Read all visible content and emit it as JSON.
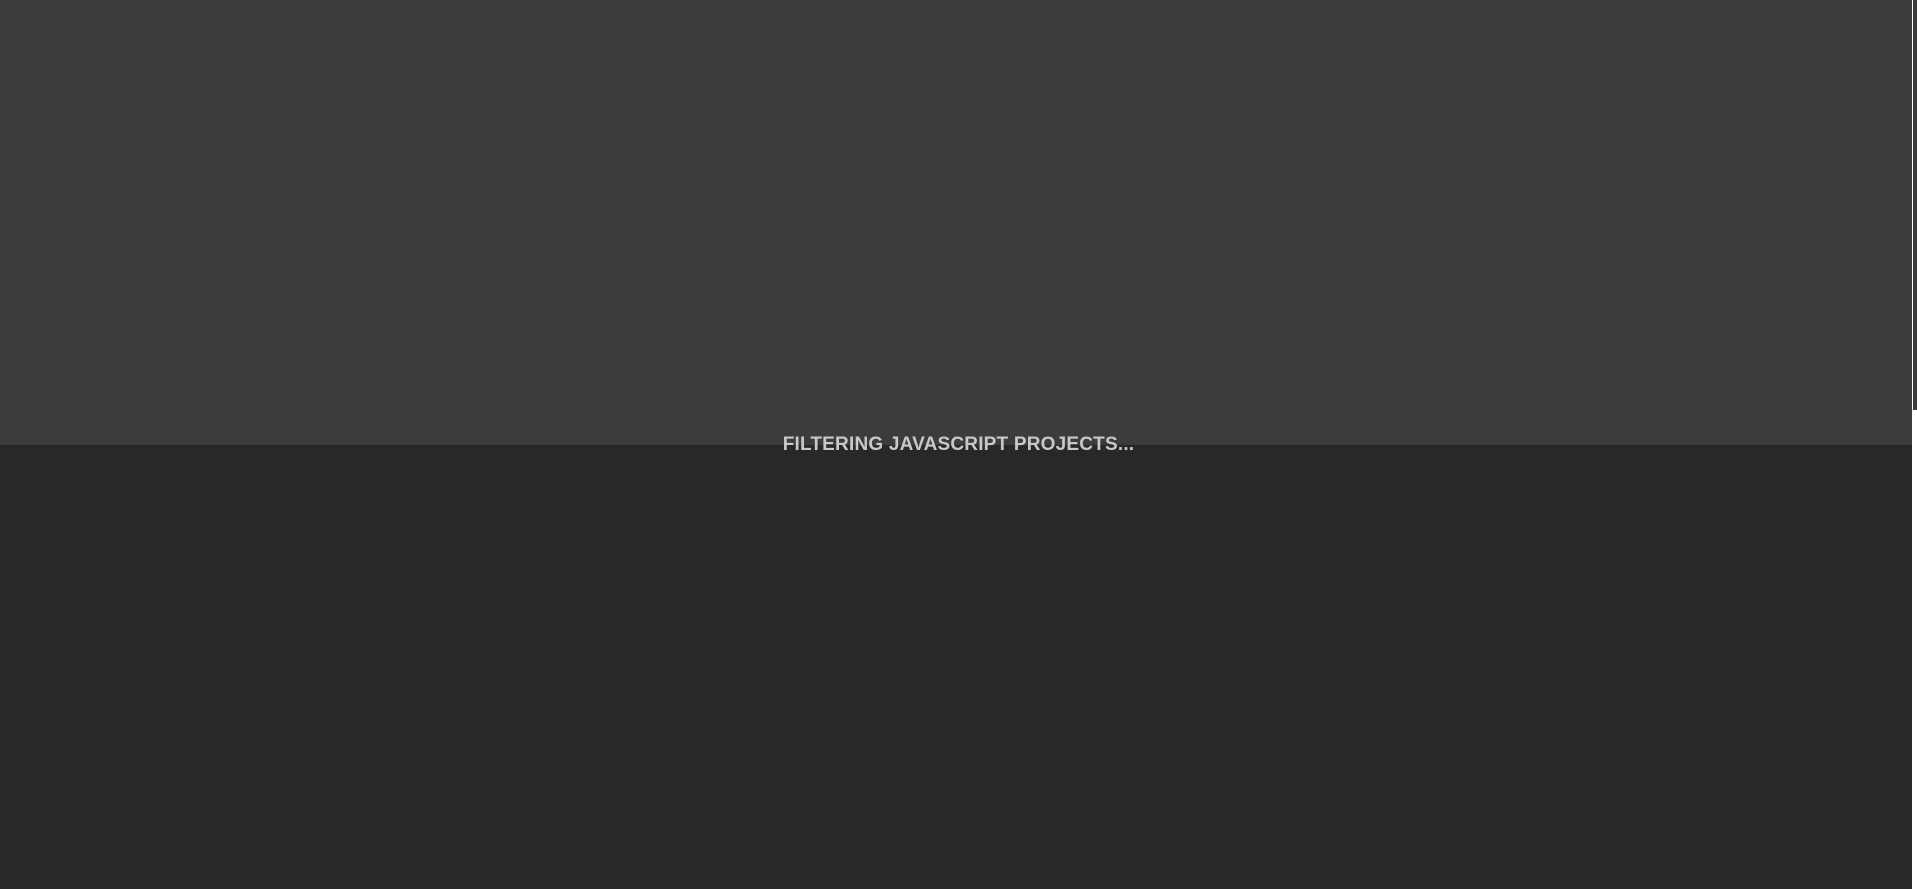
{
  "loading": {
    "message": "FILTERING JAVASCRIPT PROJECTS..."
  },
  "colors": {
    "top_background": "#3c3c3c",
    "bottom_background": "#282828",
    "text": "#c8c8c8",
    "scrollbar_track": "#ffffff"
  }
}
